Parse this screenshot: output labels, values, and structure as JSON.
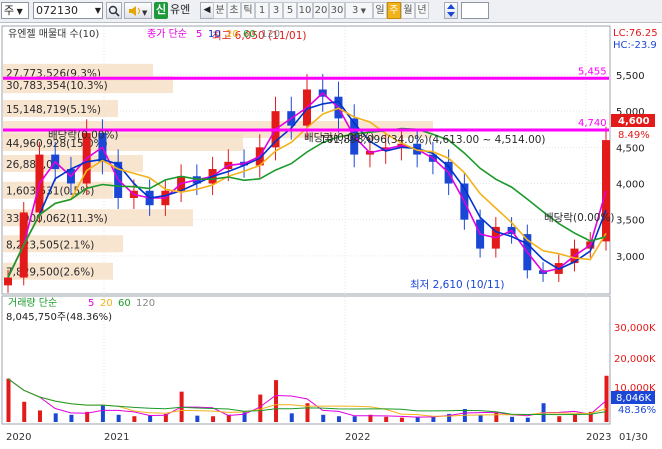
{
  "toolbar": {
    "market_label": "주",
    "code": "072130",
    "search_icon": "magnifier-icon",
    "sound_icon": "speaker-icon",
    "credit_badge": "신",
    "stock_name": "유엔",
    "period_buttons": [
      "분",
      "초",
      "틱",
      "1",
      "3",
      "5",
      "10",
      "20",
      "30",
      "3",
      "일",
      "주",
      "월",
      "년"
    ],
    "selected_period": "주",
    "colors": {
      "selected": "#f2b21a"
    }
  },
  "chart": {
    "header_left": "유엔젤 매물대 수(10)",
    "price_ma_label": "종가 단순",
    "ma_periods": [
      "5",
      "10",
      "20",
      "60",
      "120"
    ],
    "ma_colors": [
      "#e000e0",
      "#0033cc",
      "#f2b21a",
      "#1a9a2a",
      "#888888"
    ],
    "high_annotation": "최고 6,050 (11/01)",
    "low_annotation": "최저 2,610 (10/11)",
    "dividend_labels": [
      "배당락(0.00%)",
      "배당락(0.00%)",
      "배당락(0.00%)"
    ],
    "band_labels": [
      "27,773,526(9.3%)",
      "30,783,354(10.3%)",
      "15,148,719(5.1%)",
      "44,960,928(15.0%)",
      "26,889,0",
      "1,603,531(0.5%)",
      "33,900,062(11.3%)",
      "8,223,505(2.1%)",
      "7,829,500(2.6%)"
    ],
    "range_label": "101,898,096(34.0%)(4,613.00 ~ 4,514.00)",
    "hline_labels": [
      "5,455",
      "4,740"
    ],
    "right_top_labels": [
      "LC:76.25",
      "HC:-23.9"
    ],
    "current_price": "4,600",
    "current_change": "8.49%",
    "price_axis": [
      "5,500",
      "5,000",
      "4,500",
      "4,000",
      "3,500",
      "3,000"
    ],
    "price_range": [
      2500,
      6150
    ],
    "volume_header": "거래량 단순",
    "volume_ma_periods": [
      "5",
      "20",
      "60",
      "120"
    ],
    "volume_annotation": "8,045,750주(48.36%)",
    "volume_axis": [
      "30,000K",
      "20,000K",
      "10,000K"
    ],
    "volume_current": "8,046K",
    "volume_pct": "48.36%",
    "x_axis": [
      "2020",
      "2021",
      "2022",
      "2023",
      "01/30"
    ],
    "colors": {
      "up": "#e21a1a",
      "down": "#1b47d6",
      "magenta_line": "#ff00ff",
      "current_box": "#e21a1a",
      "volume_box": "#1b47d6"
    }
  },
  "chart_data": {
    "type": "candlestick",
    "period": "weekly",
    "x_ticks": [
      "2020",
      "2021",
      "2022",
      "2023"
    ],
    "y_range": [
      2500,
      6150
    ],
    "high": {
      "value": 6050,
      "date": "11/01"
    },
    "low": {
      "value": 2610,
      "date": "10/11"
    },
    "horizontal_levels": [
      5455,
      4740
    ],
    "last_close": 4600,
    "last_change_pct": 8.49,
    "last_volume_k": 8046,
    "close_series": [
      2700,
      3600,
      4400,
      4200,
      4000,
      4700,
      4300,
      3800,
      3900,
      3700,
      3900,
      4100,
      4000,
      4200,
      4300,
      4250,
      4500,
      5000,
      4800,
      5300,
      5200,
      4900,
      4400,
      4450,
      4500,
      4550,
      4400,
      4300,
      4000,
      3500,
      3100,
      3400,
      3300,
      2800,
      2750,
      2900,
      3100,
      3200,
      4600
    ],
    "volume_series_k": [
      15000,
      7000,
      4000,
      3000,
      2500,
      3500,
      6000,
      2500,
      2000,
      2200,
      2800,
      10500,
      2200,
      2000,
      2500,
      3500,
      9500,
      14500,
      3000,
      6500,
      2500,
      2000,
      2000,
      2500,
      1800,
      1500,
      1800,
      2000,
      2800,
      4500,
      2500,
      3200,
      1800,
      1500,
      6500,
      2000,
      2500,
      3500,
      16000
    ]
  }
}
